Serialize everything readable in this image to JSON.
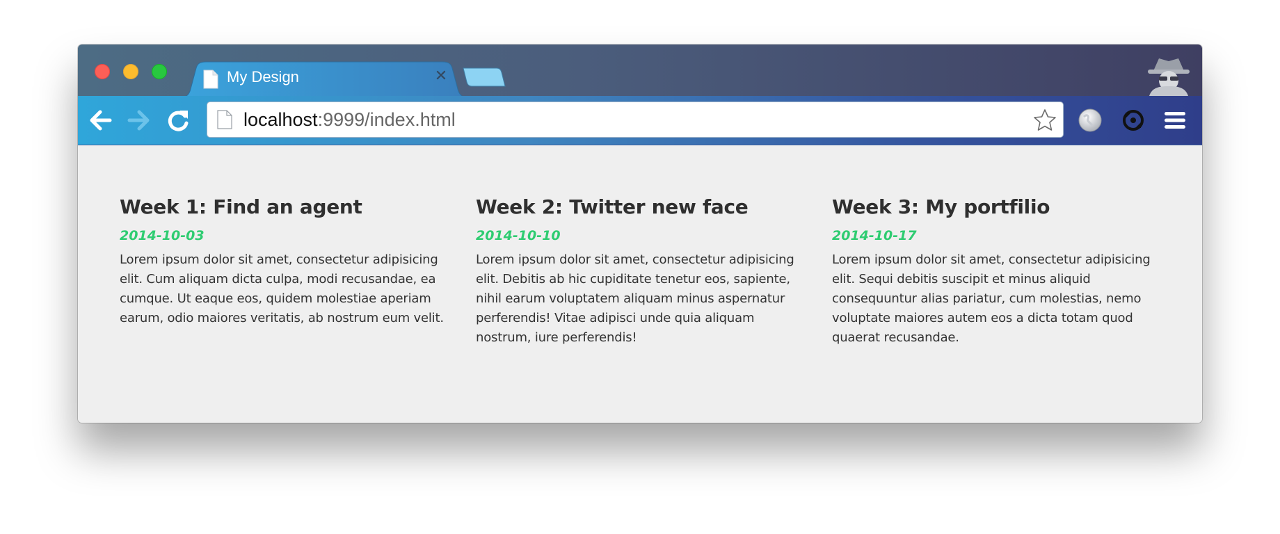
{
  "browser": {
    "tab_title": "My Design",
    "tab_close_glyph": "✕",
    "url_host": "localhost",
    "url_rest": ":9999/index.html",
    "icons": [
      "back-arrow-icon",
      "forward-arrow-icon",
      "reload-icon",
      "page-icon",
      "star-icon",
      "globe-icon",
      "sync-icon",
      "menu-icon",
      "incognito-icon"
    ],
    "colors": {
      "titlebar_start": "#4d6c84",
      "titlebar_end": "#3f3f62",
      "toolbar_start": "#2fa6da",
      "toolbar_end": "#2f3e8a",
      "tab": "#3f8fc9"
    }
  },
  "posts": [
    {
      "title": "Week 1: Find an agent",
      "date": "2014-10-03",
      "body": "Lorem ipsum dolor sit amet, consectetur adipisicing elit. Cum aliquam dicta culpa, modi recusandae, ea cumque. Ut eaque eos, quidem molestiae aperiam earum, odio maiores veritatis, ab nostrum eum velit."
    },
    {
      "title": "Week 2: Twitter new face",
      "date": "2014-10-10",
      "body": "Lorem ipsum dolor sit amet, consectetur adipisicing elit. Debitis ab hic cupiditate tenetur eos, sapiente, nihil earum voluptatem aliquam minus aspernatur perferendis! Vitae adipisci unde quia aliquam nostrum, iure perferendis!"
    },
    {
      "title": "Week 3: My portfilio",
      "date": "2014-10-17",
      "body": "Lorem ipsum dolor sit amet, consectetur adipisicing elit. Sequi debitis suscipit et minus aliquid consequuntur alias pariatur, cum molestias, nemo voluptate maiores autem eos a dicta totam quod quaerat recusandae."
    }
  ],
  "accent_date_color": "#2ecc71"
}
